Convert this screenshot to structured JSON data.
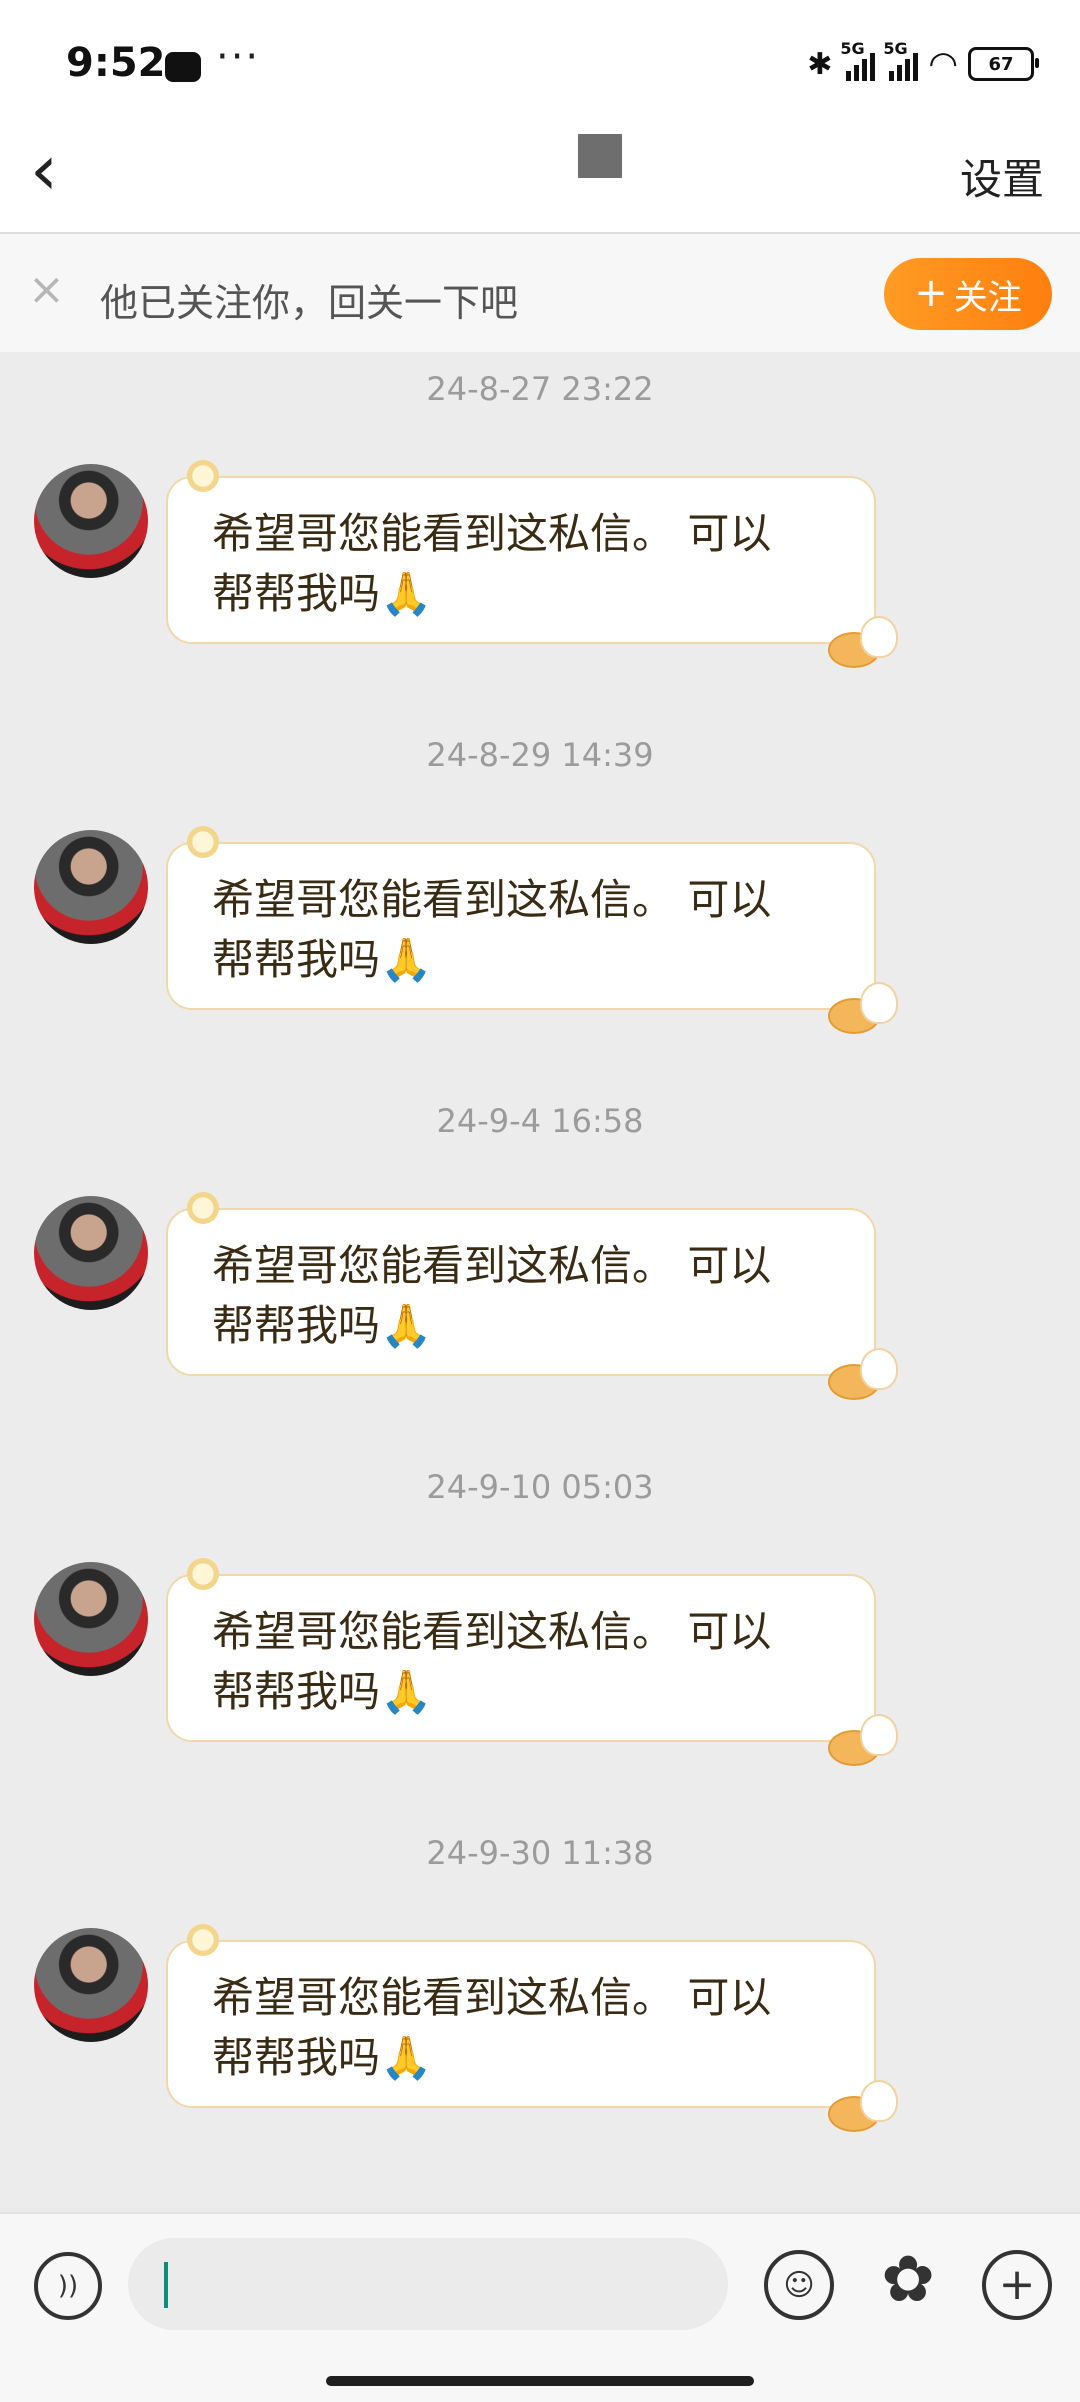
{
  "status_bar": {
    "time": "9:52",
    "notification_dots": "···",
    "network_tag_1": "5G",
    "network_tag_2": "5G",
    "battery": "67"
  },
  "nav": {
    "back_glyph": "‹",
    "settings_label": "设置"
  },
  "follow_banner": {
    "close_glyph": "×",
    "text": "他已关注你，回关一下吧",
    "button_plus": "+",
    "button_label": "关注"
  },
  "messages": [
    {
      "timestamp": "24-8-27 23:22",
      "text": "希望哥您能看到这私信。 可以帮帮我吗🙏"
    },
    {
      "timestamp": "24-8-29 14:39",
      "text": "希望哥您能看到这私信。 可以帮帮我吗🙏"
    },
    {
      "timestamp": "24-9-4 16:58",
      "text": "希望哥您能看到这私信。 可以帮帮我吗🙏"
    },
    {
      "timestamp": "24-9-10 05:03",
      "text": "希望哥您能看到这私信。 可以帮帮我吗🙏"
    },
    {
      "timestamp": "24-9-30 11:38",
      "text": "希望哥您能看到这私信。 可以帮帮我吗🙏"
    }
  ],
  "input_bar": {
    "voice_icon": "voice-icon",
    "emoji_icon": "emoji-icon",
    "sticker_icon": "sticker-icon",
    "plus_icon": "plus-icon",
    "voice_glyph": "))",
    "emoji_glyph": "☺",
    "sticker_glyph": "✿",
    "plus_glyph": "+"
  }
}
